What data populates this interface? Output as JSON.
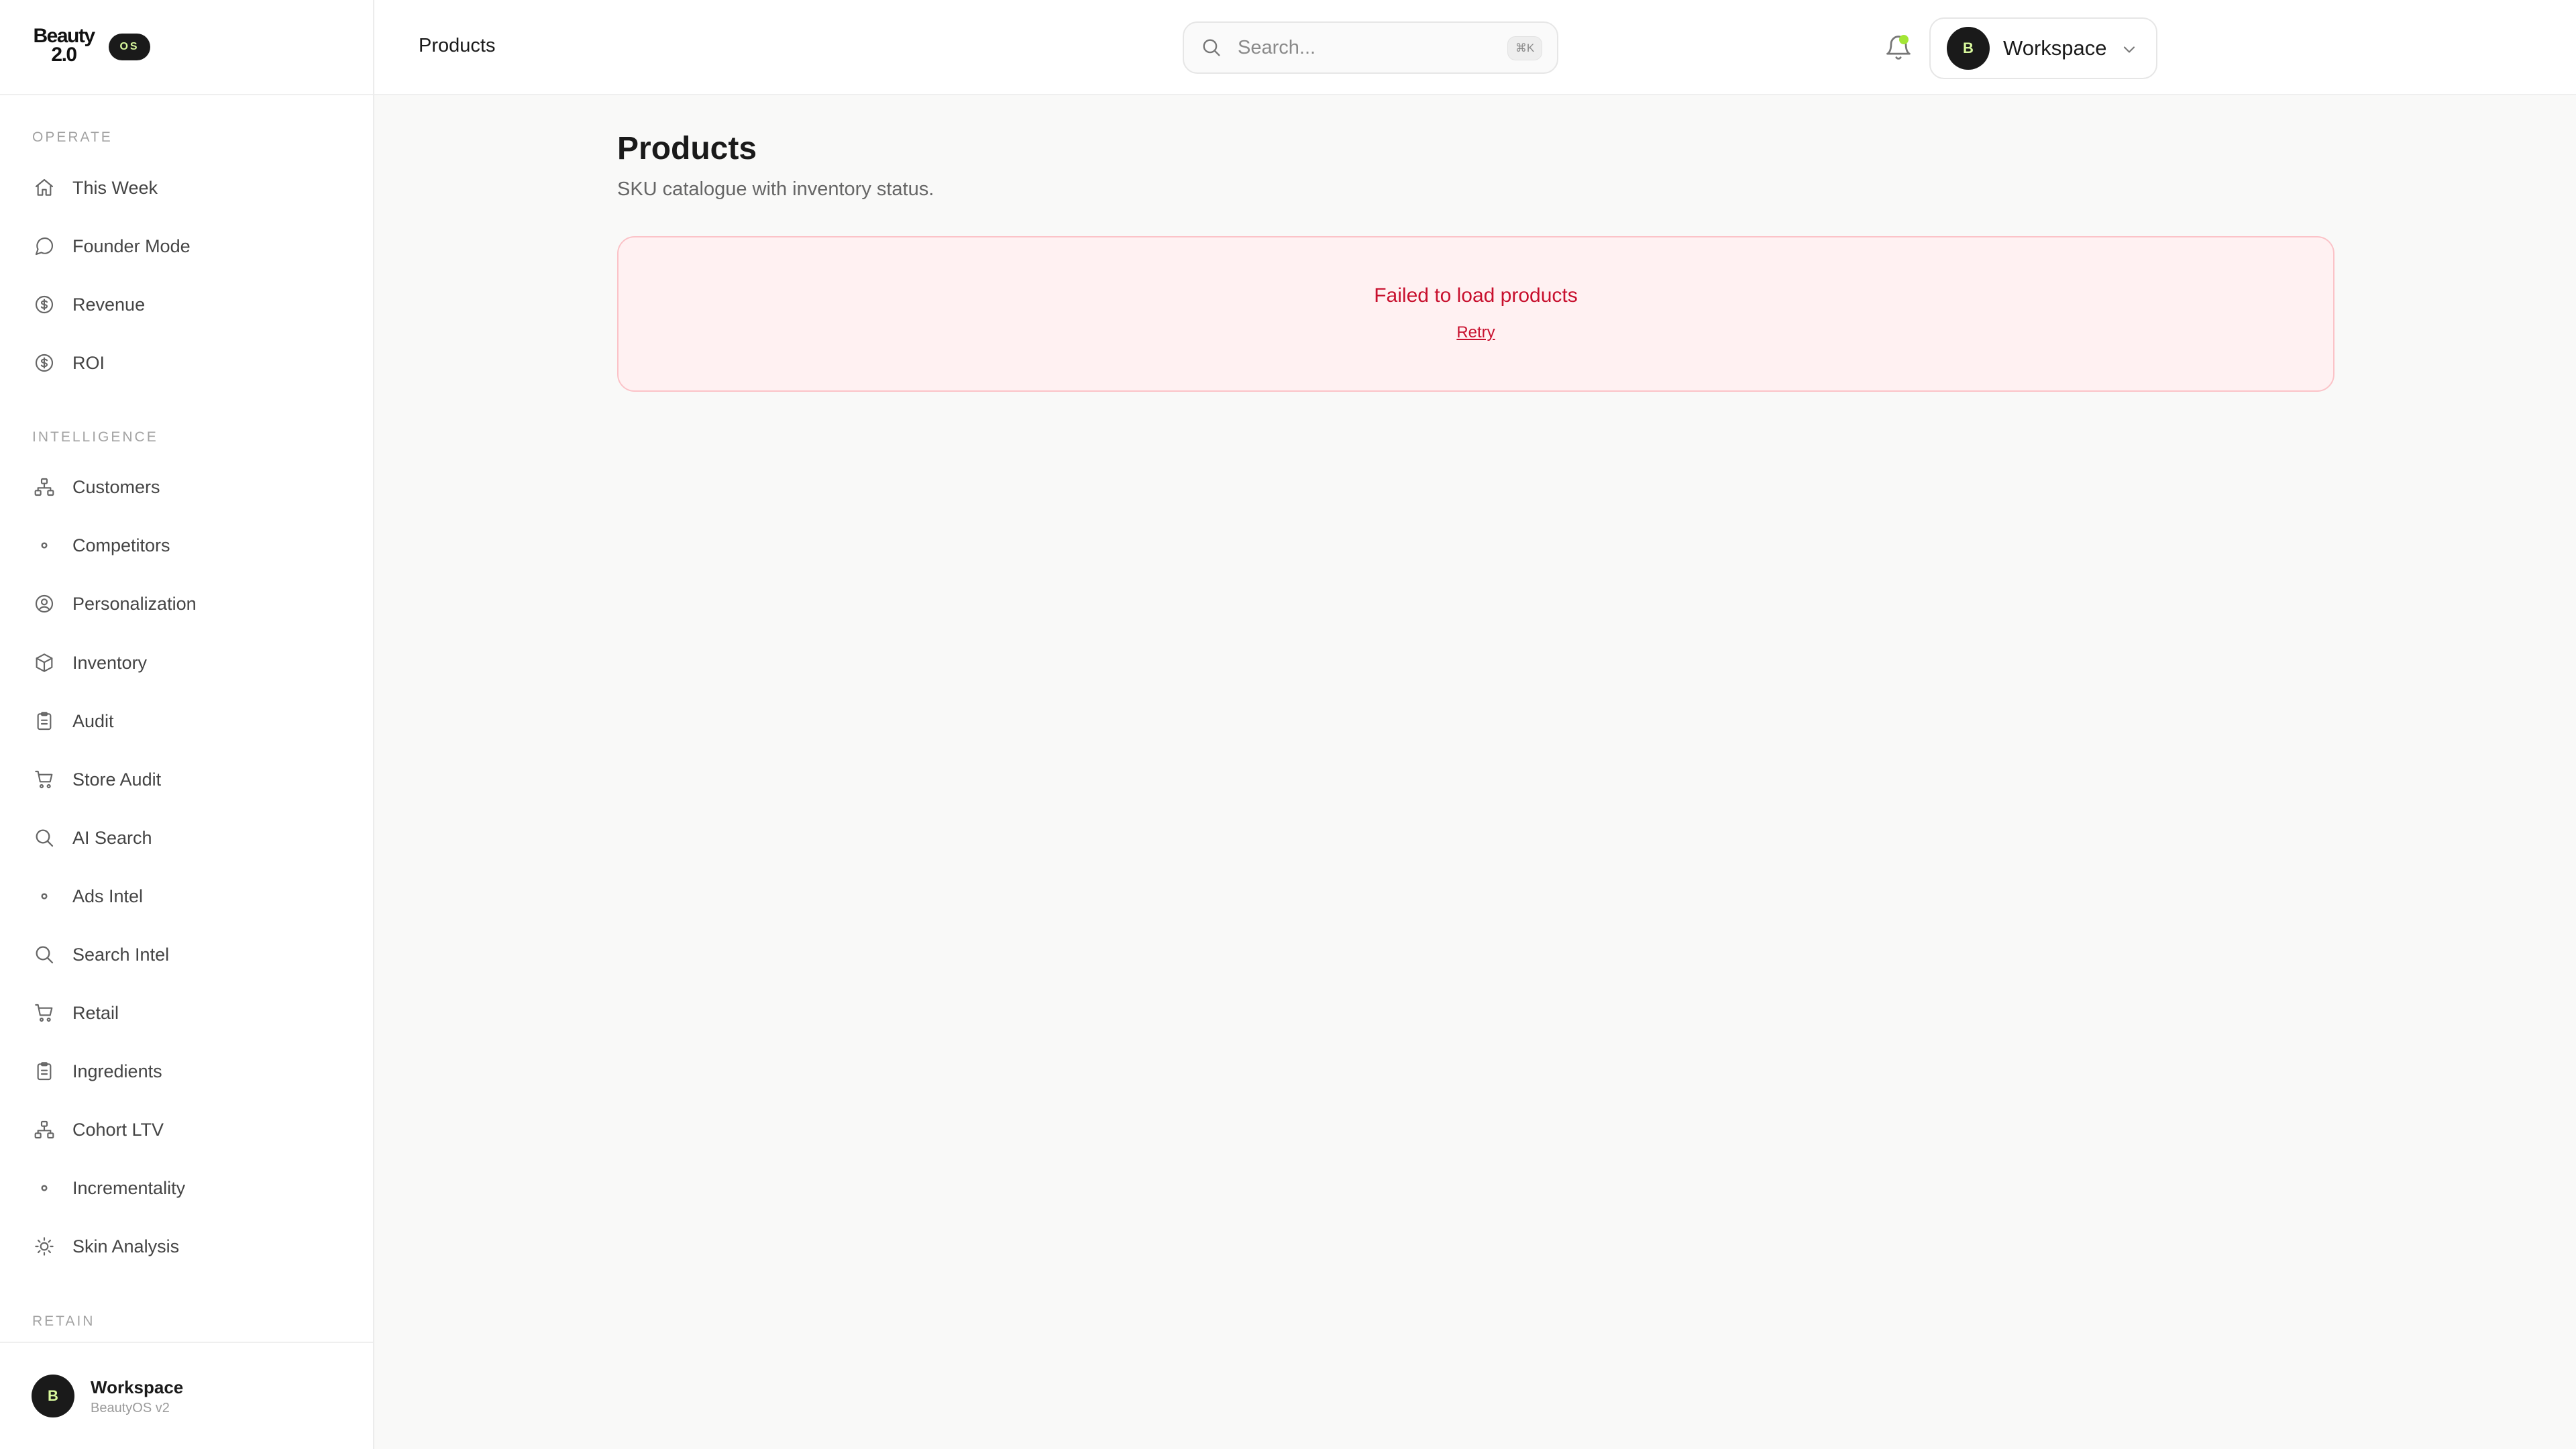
{
  "brand": {
    "logo_line1": "Beauty",
    "logo_line2": "2.0",
    "badge": "OS"
  },
  "sidebar": {
    "sections": [
      {
        "label": "OPERATE"
      },
      {
        "label": "INTELLIGENCE"
      },
      {
        "label": "RETAIN"
      }
    ],
    "items": [
      {
        "label": "This Week",
        "icon": "home-icon"
      },
      {
        "label": "Founder Mode",
        "icon": "message-circle-icon"
      },
      {
        "label": "Revenue",
        "icon": "dollar-circle-icon"
      },
      {
        "label": "ROI",
        "icon": "dollar-circle-icon"
      },
      {
        "label": "Customers",
        "icon": "network-icon"
      },
      {
        "label": "Competitors",
        "icon": "dot-icon"
      },
      {
        "label": "Personalization",
        "icon": "user-circle-icon"
      },
      {
        "label": "Inventory",
        "icon": "box-icon"
      },
      {
        "label": "Audit",
        "icon": "clipboard-icon"
      },
      {
        "label": "Store Audit",
        "icon": "cart-icon"
      },
      {
        "label": "AI Search",
        "icon": "search-icon"
      },
      {
        "label": "Ads Intel",
        "icon": "dot-icon"
      },
      {
        "label": "Search Intel",
        "icon": "search-icon"
      },
      {
        "label": "Retail",
        "icon": "cart-icon"
      },
      {
        "label": "Ingredients",
        "icon": "clipboard-icon"
      },
      {
        "label": "Cohort LTV",
        "icon": "network-icon"
      },
      {
        "label": "Incrementality",
        "icon": "dot-icon"
      },
      {
        "label": "Skin Analysis",
        "icon": "sun-icon"
      }
    ],
    "footer": {
      "avatar": "B",
      "name": "Workspace",
      "sub": "BeautyOS v2"
    }
  },
  "topbar": {
    "title": "Products",
    "search_placeholder": "Search...",
    "shortcut": "⌘K",
    "workspace_avatar": "B",
    "workspace_label": "Workspace"
  },
  "main": {
    "title": "Products",
    "subtitle": "SKU catalogue with inventory status.",
    "error_message": "Failed to load products",
    "retry_label": "Retry"
  },
  "colors": {
    "accent": "#a3e635",
    "error_text": "#c8102e",
    "error_bg": "#fff1f2",
    "error_border": "#fbc3c8",
    "dark": "#1a1a1a"
  }
}
